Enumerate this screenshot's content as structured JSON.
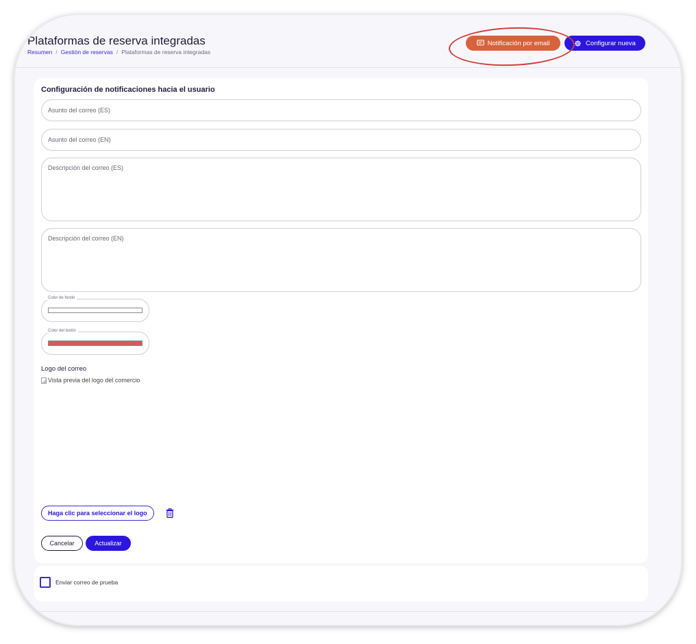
{
  "header": {
    "title": "Plataformas de reserva integradas",
    "breadcrumb": {
      "items": [
        "Resumen",
        "Gestión de reservas",
        "Plataformas de reserva integradas"
      ],
      "separator": "/"
    },
    "email_button_label": "Notificación por email",
    "email_button_icon": "message-square-icon",
    "config_button_label": "Configurar nueva",
    "config_button_icon": "gear-icon"
  },
  "form": {
    "title": "Configuración de notificaciones hacia el usuario",
    "subject_es_placeholder": "Asunto del correo (ES)",
    "subject_en_placeholder": "Asunto del correo (EN)",
    "description_es_placeholder": "Descripción del correo (ES)",
    "description_en_placeholder": "Descripción del correo (EN)",
    "background_color_label": "Color de fondo",
    "background_color_value": "#ffffff",
    "button_color_label": "Color del botón",
    "button_color_value": "#d35b5b",
    "logo_label": "Logo del correo",
    "logo_alt_text": "Vista previa del logo del comercio",
    "select_logo_label": "Haga clic para seleccionar el logo",
    "delete_icon": "trash-icon",
    "cancel_label": "Cancelar",
    "update_label": "Actualizar"
  },
  "test_email": {
    "checked": false,
    "label": "Enviar correo de prueba"
  },
  "colors": {
    "primary": "#2b16e0",
    "email_button": "#d7623b",
    "highlight_ring": "#d63a3a",
    "text_dark": "#1e1b3a"
  }
}
